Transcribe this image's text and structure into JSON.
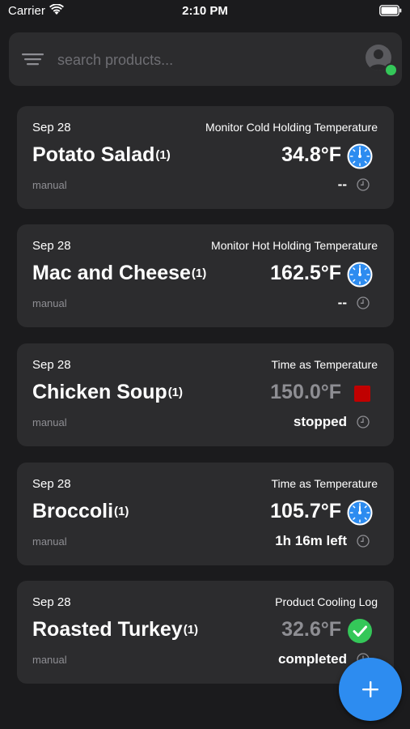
{
  "status_bar": {
    "carrier": "Carrier",
    "time": "2:10 PM"
  },
  "search": {
    "placeholder": "search products..."
  },
  "colors": {
    "background": "#1b1b1d",
    "card": "#2c2c2e",
    "accent": "#2d8cf0",
    "online": "#34c759",
    "stopped": "#c00000",
    "muted": "#8e8e93"
  },
  "cards": [
    {
      "date": "Sep 28",
      "type": "Monitor Cold Holding Temperature",
      "name": "Potato Salad",
      "count": "(1)",
      "temperature": "34.8°F",
      "source": "manual",
      "status": "--",
      "icon": "gauge-icon"
    },
    {
      "date": "Sep 28",
      "type": "Monitor Hot Holding Temperature",
      "name": "Mac and Cheese",
      "count": "(1)",
      "temperature": "162.5°F",
      "source": "manual",
      "status": "--",
      "icon": "gauge-icon"
    },
    {
      "date": "Sep 28",
      "type": "Time as Temperature",
      "name": "Chicken Soup",
      "count": "(1)",
      "temperature": "150.0°F",
      "source": "manual",
      "status": "stopped",
      "icon": "stop-icon"
    },
    {
      "date": "Sep 28",
      "type": "Time as Temperature",
      "name": "Broccoli",
      "count": "(1)",
      "temperature": "105.7°F",
      "source": "manual",
      "status": "1h 16m left",
      "icon": "gauge-icon"
    },
    {
      "date": "Sep 28",
      "type": "Product Cooling Log",
      "name": "Roasted Turkey",
      "count": "(1)",
      "temperature": "32.6°F",
      "source": "manual",
      "status": "completed",
      "icon": "check-icon"
    }
  ]
}
